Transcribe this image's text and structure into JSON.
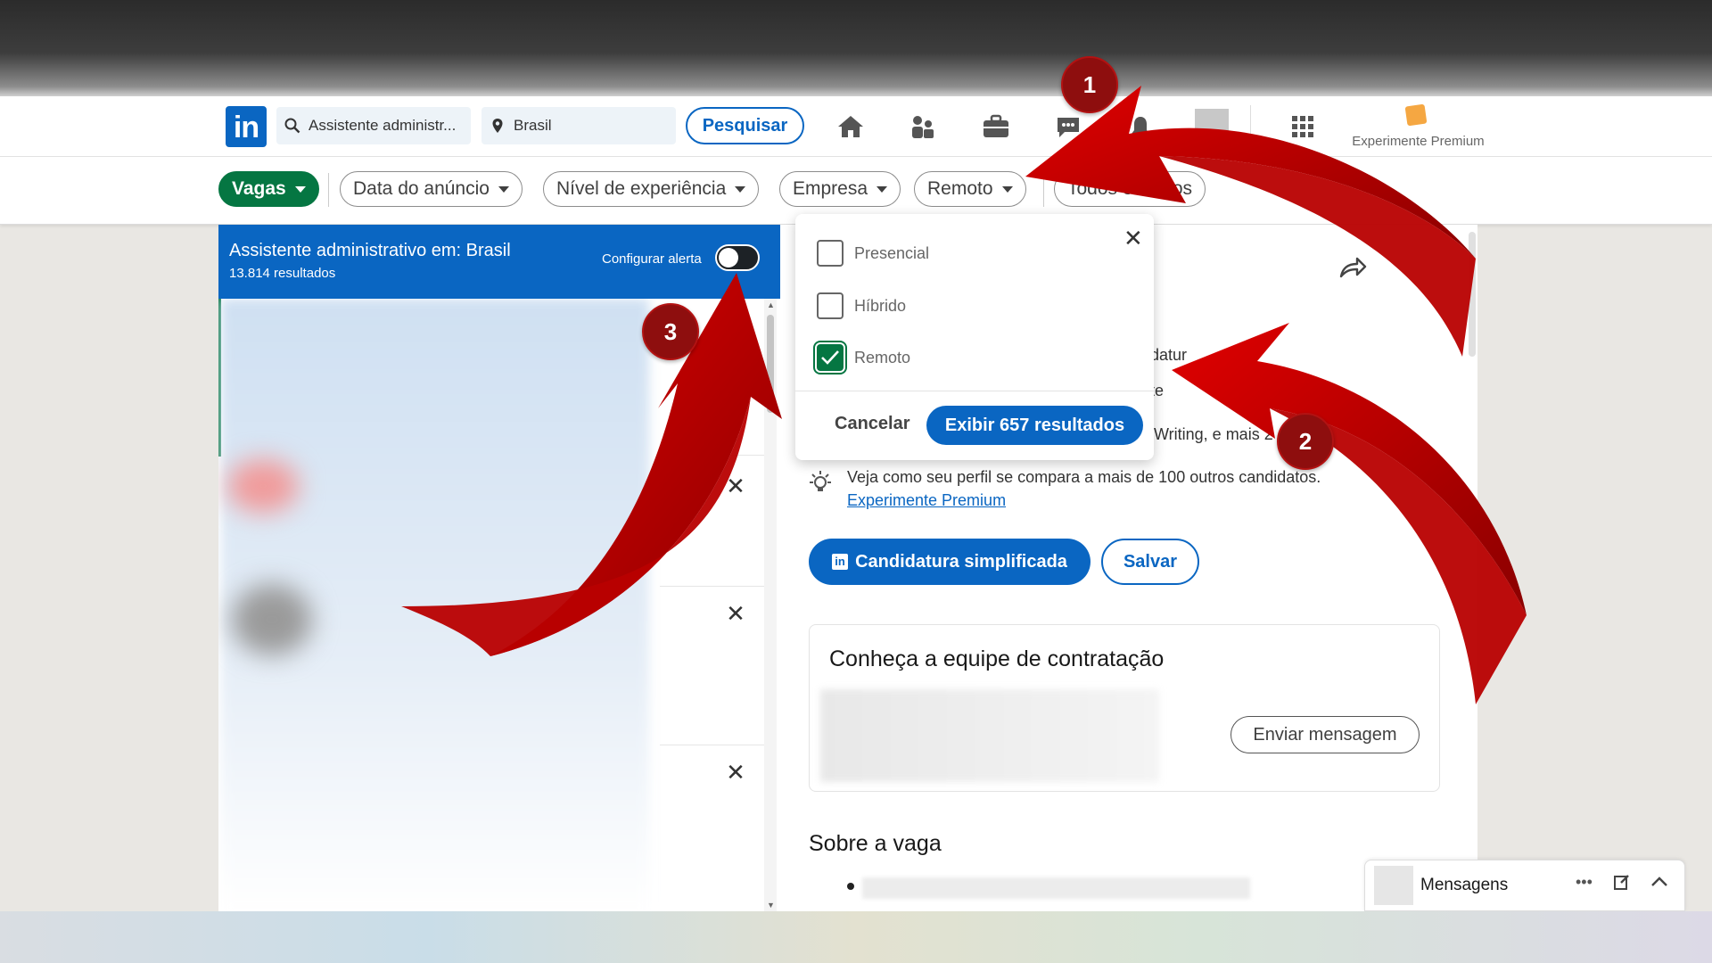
{
  "nav": {
    "search_keyword": "Assistente administr...",
    "search_location": "Brasil",
    "search_button": "Pesquisar",
    "premium_label": "Experimente Premium",
    "icons": [
      "home-icon",
      "network-icon",
      "jobs-icon",
      "messaging-icon",
      "notifications-icon",
      "grid-icon"
    ]
  },
  "filters": {
    "vagas": "Vagas",
    "data_anuncio": "Data do anúncio",
    "nivel": "Nível de experiência",
    "empresa": "Empresa",
    "remoto": "Remoto",
    "todos": "Todos os filtros"
  },
  "results": {
    "title": "Assistente administrativo em: Brasil",
    "count": "13.814 resultados",
    "alert_label": "Configurar alerta",
    "alert_on": false
  },
  "popup": {
    "options": [
      {
        "label": "Presencial",
        "checked": false
      },
      {
        "label": "Híbrido",
        "checked": false
      },
      {
        "label": "Remoto",
        "checked": true
      }
    ],
    "cancel": "Cancelar",
    "show": "Exibir 657 resultados"
  },
  "detail": {
    "partial_1": "datur",
    "partial_2": "te",
    "partial_3": "Writing, e mais 2",
    "insight_text": "Veja como seu perfil se compara a mais de 100 outros candidatos.",
    "insight_link": "Experimente Premium",
    "apply": "Candidatura simplificada",
    "save": "Salvar",
    "team_title": "Conheça a equipe de contratação",
    "send_message": "Enviar mensagem",
    "about_title": "Sobre a vaga"
  },
  "dock": {
    "label": "Mensagens"
  },
  "annotations": {
    "badges": [
      "1",
      "2",
      "3"
    ],
    "color": "#8e0e0e",
    "arrow_color": "#cc0000"
  },
  "colors": {
    "brand": "#0a66c2",
    "green": "#057642"
  }
}
